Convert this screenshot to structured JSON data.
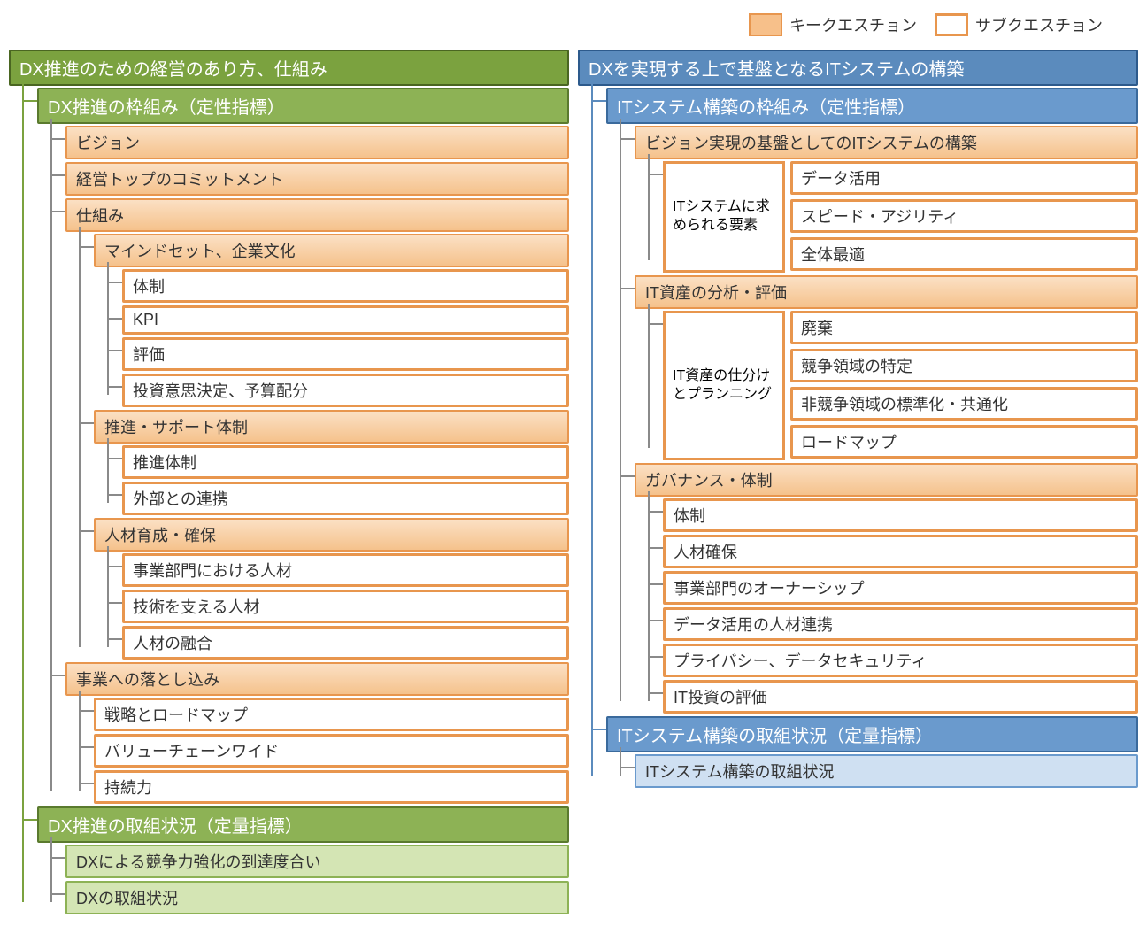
{
  "legend": {
    "key": "キークエスチョン",
    "sub": "サブクエスチョン"
  },
  "left": {
    "title": "DX推進のための経営のあり方、仕組み",
    "s1": {
      "title": "DX推進の枠組み（定性指標）",
      "i1": "ビジョン",
      "i2": "経営トップのコミットメント",
      "i3": "仕組み",
      "i3a": "マインドセット、企業文化",
      "i3a1": "体制",
      "i3a2": "KPI",
      "i3a3": "評価",
      "i3a4": "投資意思決定、予算配分",
      "i3b": "推進・サポート体制",
      "i3b1": "推進体制",
      "i3b2": "外部との連携",
      "i3c": "人材育成・確保",
      "i3c1": "事業部門における人材",
      "i3c2": "技術を支える人材",
      "i3c3": "人材の融合",
      "i4": "事業への落とし込み",
      "i4a": "戦略とロードマップ",
      "i4b": "バリューチェーンワイド",
      "i4c": "持続力"
    },
    "s2": {
      "title": "DX推進の取組状況（定量指標）",
      "i1": "DXによる競争力強化の到達度合い",
      "i2": "DXの取組状況"
    }
  },
  "right": {
    "title": "DXを実現する上で基盤となるITシステムの構築",
    "s1": {
      "title": "ITシステム構築の枠組み（定性指標）",
      "i1": "ビジョン実現の基盤としてのITシステムの構築",
      "i1box": "ITシステムに求められる要素",
      "i1a": "データ活用",
      "i1b": "スピード・アジリティ",
      "i1c": "全体最適",
      "i2": "IT資産の分析・評価",
      "i2box": "IT資産の仕分けとプランニング",
      "i2a": "廃棄",
      "i2b": "競争領域の特定",
      "i2c": "非競争領域の標準化・共通化",
      "i2d": "ロードマップ",
      "i3": "ガバナンス・体制",
      "i3a": "体制",
      "i3b": "人材確保",
      "i3c": "事業部門のオーナーシップ",
      "i3d": "データ活用の人材連携",
      "i3e": "プライバシー、データセキュリティ",
      "i3f": "IT投資の評価"
    },
    "s2": {
      "title": "ITシステム構築の取組状況（定量指標）",
      "i1": "ITシステム構築の取組状況"
    }
  }
}
